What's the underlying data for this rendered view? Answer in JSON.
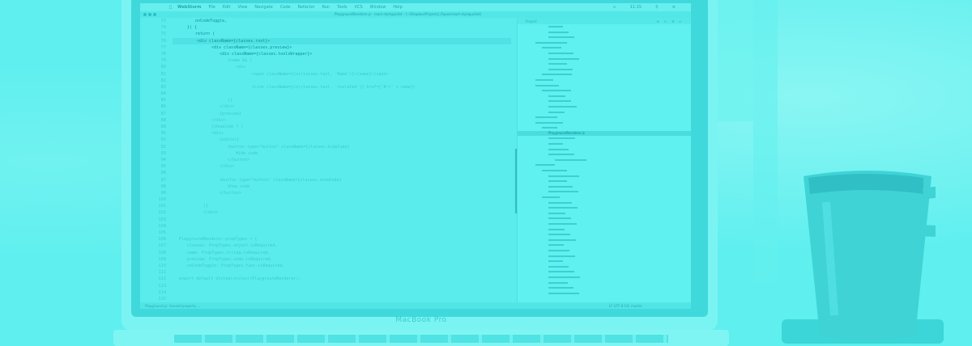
{
  "device": {
    "brand_label": "MacBook Pro"
  },
  "menubar": {
    "apple": "",
    "items": [
      "WebStorm",
      "File",
      "Edit",
      "View",
      "Navigate",
      "Code",
      "Refactor",
      "Run",
      "Tools",
      "VCS",
      "Window",
      "Help"
    ],
    "clock": "11:15"
  },
  "window": {
    "title": "PlaygroundRenderer.js - react-styleguidist - [~/Dropbox/Projects/_Repos/react-styleguidist]"
  },
  "editor": {
    "line_numbers": [
      "73",
      "74",
      "75",
      "76",
      "77",
      "78",
      "79",
      "80",
      "81",
      "82",
      "83",
      "84",
      "85",
      "86",
      "87",
      "88",
      "89",
      "90",
      "91",
      "92",
      "93",
      "94",
      "95",
      "96",
      "97",
      "98",
      "99",
      "100",
      "101",
      "102",
      "103",
      "104",
      "105",
      "106",
      "107",
      "108",
      "109",
      "110",
      "111",
      "112",
      "113",
      "114",
      "115"
    ],
    "lines": [
      "onCodeToggle,",
      "}) {",
      "return (",
      "<div className={classes.root}>",
      "<div className={classes.preview}>",
      "<div className={classes.toolsWrapper}>",
      "{name && (",
      "<div",
      "<span className={cx(classes.tool, 'Name')}>{name}</span>",
      "",
      "<Link className={cx(classes.tool, 'isolated')} href={'#!/' + name}>",
      "",
      ")}",
      "</div>",
      "{preview}",
      "</div>",
      "{showCode ? (",
      "<div>",
      "{editor}",
      "<button type=\"button\" className={classes.hideCode}",
      "Hide code",
      "</button>",
      "</div>",
      "",
      "<button type=\"button\" className={classes.showCode}",
      "Show code",
      "</button>",
      "",
      ")}",
      "</div>",
      "",
      "",
      "",
      "PlaygroundRenderer.propTypes = {",
      "classes: PropTypes.object.isRequired,",
      "name: PropTypes.string.isRequired,",
      "preview: PropTypes.node.isRequired,",
      "onCodeToggle: PropTypes.func.isRequired,",
      "",
      "export default Styled(styles)(PlaygroundRenderer);",
      "",
      "",
      ""
    ]
  },
  "project": {
    "header": "Project",
    "selected_file": "PlaygroundRenderer.js"
  },
  "statusbar": {
    "left": "Playground.js: Unused property ...",
    "right": "LF  UTF-8  Git: master"
  }
}
